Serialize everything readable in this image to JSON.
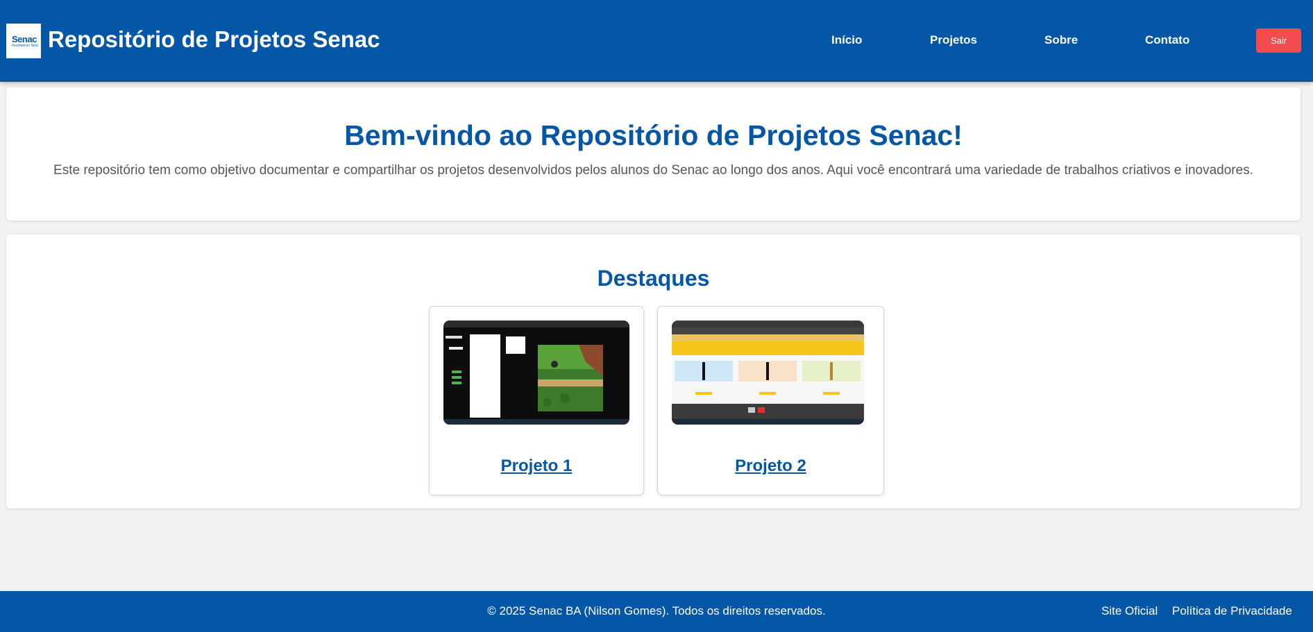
{
  "header": {
    "logo": {
      "main": "Senac",
      "sub": "Fecomércio Sesc"
    },
    "title": "Repositório de Projetos Senac",
    "nav": [
      "Início",
      "Projetos",
      "Sobre",
      "Contato"
    ],
    "logout_label": "Sair"
  },
  "welcome": {
    "title": "Bem-vindo ao Repositório de Projetos Senac!",
    "description": "Este repositório tem como objetivo documentar e compartilhar os projetos desenvolvidos pelos alunos do Senac ao longo dos anos. Aqui você encontrará uma variedade de trabalhos criativos e inovadores."
  },
  "highlights": {
    "title": "Destaques",
    "projects": [
      {
        "label": "Projeto 1"
      },
      {
        "label": "Projeto 2"
      }
    ]
  },
  "footer": {
    "copyright": "© 2025 Senac BA (Nilson Gomes). Todos os direitos reservados.",
    "links": [
      "Site Oficial",
      "Política de Privacidade"
    ]
  },
  "colors": {
    "brand": "#0456a6",
    "logout": "#f44b4f",
    "background": "#f2f2f2"
  }
}
